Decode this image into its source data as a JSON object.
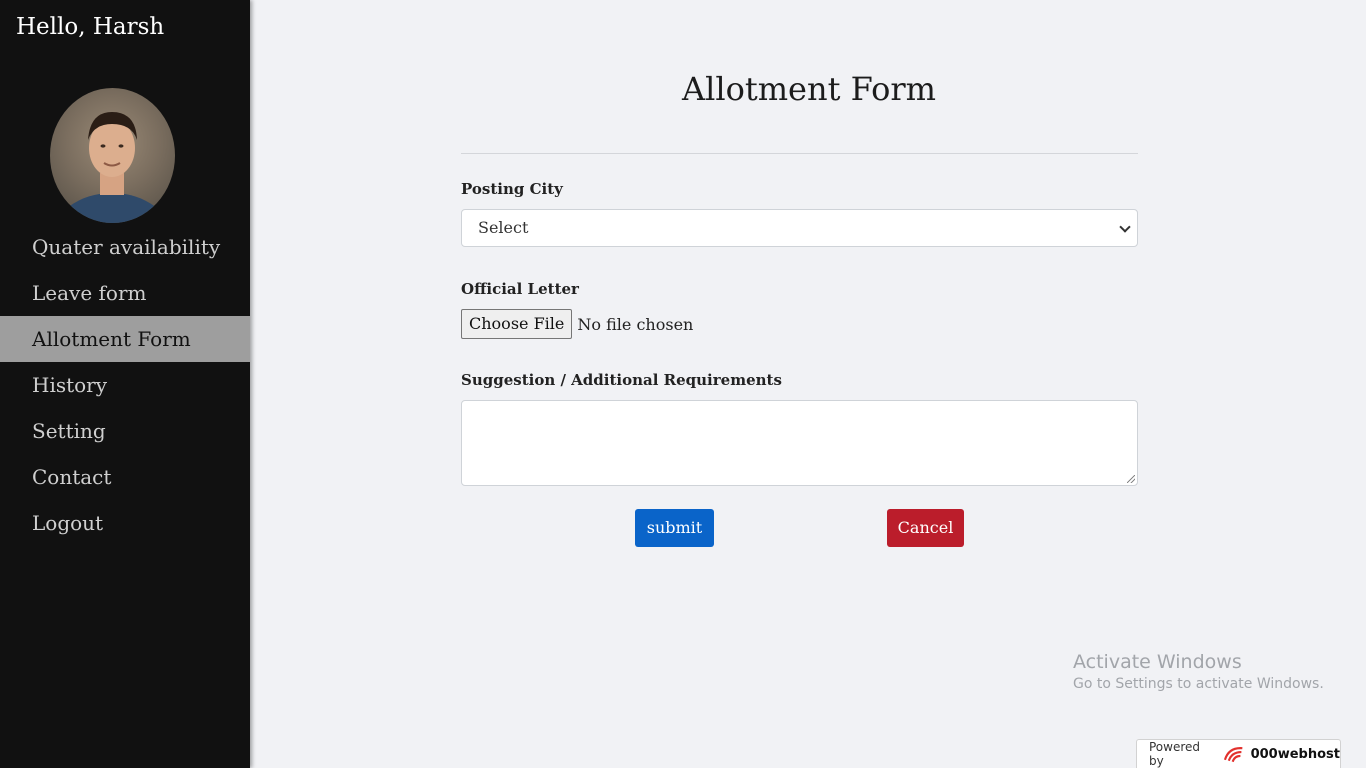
{
  "sidebar": {
    "greeting": "Hello, Harsh",
    "items": [
      {
        "label": "Quater availability",
        "active": false
      },
      {
        "label": "Leave form",
        "active": false
      },
      {
        "label": "Allotment Form",
        "active": true
      },
      {
        "label": "History",
        "active": false
      },
      {
        "label": "Setting",
        "active": false
      },
      {
        "label": "Contact",
        "active": false
      },
      {
        "label": "Logout",
        "active": false
      }
    ]
  },
  "form": {
    "title": "Allotment Form",
    "posting_city": {
      "label": "Posting City",
      "selected": "Select"
    },
    "official_letter": {
      "label": "Official Letter",
      "button": "Choose File",
      "status": "No file chosen"
    },
    "suggestion": {
      "label": "Suggestion / Additional Requirements",
      "value": ""
    },
    "submit_label": "submit",
    "cancel_label": "Cancel"
  },
  "watermark": {
    "title": "Activate Windows",
    "subtitle": "Go to Settings to activate Windows."
  },
  "powered": {
    "prefix": "Powered by",
    "brand": "000webhost"
  },
  "colors": {
    "sidebar_bg": "#111111",
    "active_item_bg": "#9e9e9e",
    "submit": "#0a64c9",
    "cancel": "#bb1d2b",
    "page_bg": "#f1f2f5"
  }
}
